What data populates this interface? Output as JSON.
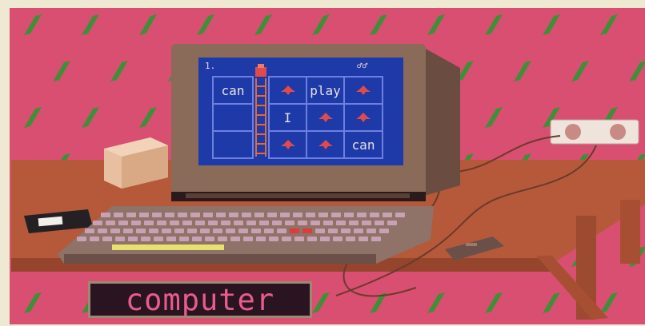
{
  "scene": {
    "caption": "computer",
    "level_indicator": "1.",
    "score_indicator": "♂♂"
  },
  "word_grid": {
    "cells": [
      [
        "can",
        "",
        "ship",
        "play",
        "ship"
      ],
      [
        "",
        "",
        "I",
        "ship",
        "ship"
      ],
      [
        "",
        "",
        "ship",
        "ship",
        "can"
      ]
    ]
  },
  "colors": {
    "wallpaper": "#d84f72",
    "leaf": "#3f8f38",
    "desk": "#b5593a",
    "monitor_case": "#8a6a58",
    "screen": "#1d3aa8",
    "grid_lines": "#6f7fe0",
    "caption_text": "#e65c8a"
  }
}
